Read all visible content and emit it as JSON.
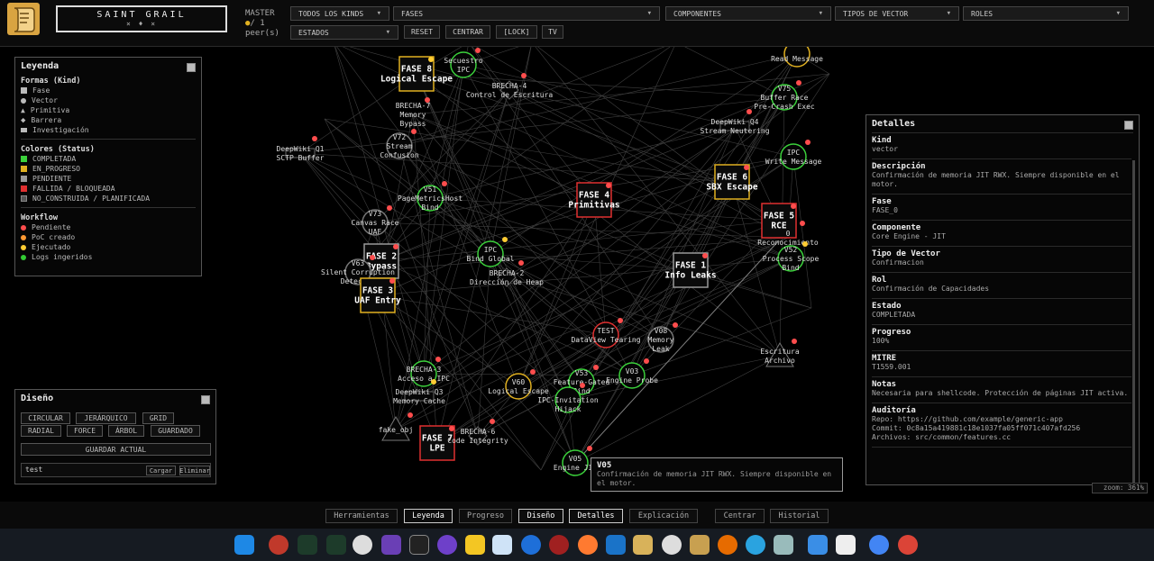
{
  "app": {
    "title": "SAINT GRAIL",
    "subtitle": "× ♦ ×",
    "master_label": "MASTER",
    "peers": "/ 1",
    "peers_label": "peer(s)"
  },
  "filters": {
    "kinds": "TODOS LOS KINDS",
    "fases": "FASES",
    "componentes": "COMPONENTES",
    "tipos": "TIPOS DE VECTOR",
    "roles": "ROLES",
    "estados": "ESTADOS",
    "reset": "RESET",
    "centrar": "CENTRAR",
    "lock": "[LOCK]",
    "tv": "TV"
  },
  "legend": {
    "title": "Leyenda",
    "shapes_title": "Formas (Kind)",
    "shapes": [
      "Fase",
      "Vector",
      "Primitiva",
      "Barrera",
      "Investigación"
    ],
    "colors_title": "Colores (Status)",
    "colors": [
      {
        "label": "COMPLETADA",
        "color": "#3bd13b"
      },
      {
        "label": "EN_PROGRESO",
        "color": "#e0b020"
      },
      {
        "label": "PENDIENTE",
        "color": "#999999"
      },
      {
        "label": "FALLIDA / BLOQUEADA",
        "color": "#e03030"
      },
      {
        "label": "NO_CONSTRUIDA / PLANIFICADA",
        "color": "#555555"
      }
    ],
    "workflow_title": "Workflow",
    "workflow": [
      {
        "label": "Pendiente",
        "color": "#ff4d4d"
      },
      {
        "label": "PoC creado",
        "color": "#ff9933"
      },
      {
        "label": "Ejecutado",
        "color": "#ffcc33"
      },
      {
        "label": "Logs ingeridos",
        "color": "#33cc33"
      }
    ]
  },
  "design": {
    "title": "Diseño",
    "layouts": [
      "CIRCULAR",
      "JERÁRQUICO",
      "GRID",
      "RADIAL",
      "FORCE",
      "ÁRBOL",
      "GUARDADO"
    ],
    "save": "GUARDAR ACTUAL",
    "input_value": "test",
    "load": "Cargar",
    "delete": "Eliminar"
  },
  "details": {
    "title": "Detalles",
    "fields": [
      {
        "k": "Kind",
        "v": "vector"
      },
      {
        "k": "Descripción",
        "v": "Confirmación de memoria JIT RWX. Siempre disponible en el motor."
      },
      {
        "k": "Fase",
        "v": "FASE_0"
      },
      {
        "k": "Componente",
        "v": "Core Engine - JIT"
      },
      {
        "k": "Tipo de Vector",
        "v": "Confirmacion"
      },
      {
        "k": "Rol",
        "v": "Confirmación de Capacidades"
      },
      {
        "k": "Estado",
        "v": "COMPLETADA"
      },
      {
        "k": "Progreso",
        "v": "100%"
      },
      {
        "k": "MITRE",
        "v": "T1559.001"
      },
      {
        "k": "Notas",
        "v": "Necesaria para shellcode. Protección de páginas JIT activa."
      },
      {
        "k": "Auditoría",
        "v": "Repo: https://github.com/example/generic-app\nCommit: 0c8a15a419881c18e1037fa05ff071c407afd256\nArchivos: src/common/features.cc"
      }
    ]
  },
  "zoom": "zoom: 361%",
  "tooltip": {
    "title": "V05",
    "text": "Confirmación de memoria JIT RWX. Siempre disponible en el motor."
  },
  "bottom": [
    "Herramientas",
    "Leyenda",
    "Progreso",
    "Diseño",
    "Detalles",
    "Explicación",
    "Centrar",
    "Historial"
  ],
  "bottom_active": [
    "Leyenda",
    "Diseño",
    "Detalles"
  ],
  "graph": {
    "nodes": [
      {
        "id": "f8",
        "t": "phase",
        "lines": [
          "FASE 8",
          "Logical Escape"
        ],
        "c": "#e0b020"
      },
      {
        "id": "sec",
        "t": "vector",
        "lines": [
          "Secuestro",
          "IPC"
        ],
        "c": "#3bd13b"
      },
      {
        "id": "b4",
        "t": "barrier",
        "lines": [
          "BRECHA-4",
          "Control de Escritura"
        ],
        "c": "#777"
      },
      {
        "id": "b7",
        "t": "text",
        "lines": [
          "BRECHA-7",
          "Memory",
          "Bypass"
        ],
        "c": "#777"
      },
      {
        "id": "v72",
        "t": "vector",
        "lines": [
          "V72",
          "Stream",
          "Confusion"
        ],
        "c": "#777"
      },
      {
        "id": "dw1",
        "t": "research",
        "lines": [
          "DeepWiki Q1",
          "SCTP Buffer"
        ],
        "c": "#777"
      },
      {
        "id": "v51",
        "t": "vector",
        "lines": [
          "V51",
          "PageMetricsHost",
          "Bind"
        ],
        "c": "#3bd13b"
      },
      {
        "id": "v73",
        "t": "vector",
        "lines": [
          "V73",
          "Canvas Race",
          "UAF"
        ],
        "c": "#777"
      },
      {
        "id": "f4",
        "t": "phase",
        "lines": [
          "FASE 4",
          "Primitivas"
        ],
        "c": "#e03030"
      },
      {
        "id": "ipcg",
        "t": "vector",
        "lines": [
          "IPC",
          "Bind Global"
        ],
        "c": "#3bd13b"
      },
      {
        "id": "b2",
        "t": "barrier",
        "lines": [
          "BRECHA-2",
          "Dirección de Heap"
        ],
        "c": "#777"
      },
      {
        "id": "f2",
        "t": "phase",
        "lines": [
          "FASE 2",
          "Bypass"
        ],
        "c": "#999"
      },
      {
        "id": "v63",
        "t": "vector",
        "lines": [
          "V63",
          "Silent Corruption",
          "Detector"
        ],
        "c": "#777"
      },
      {
        "id": "f3",
        "t": "phase",
        "lines": [
          "FASE 3",
          "UAF Entry"
        ],
        "c": "#e0b020"
      },
      {
        "id": "f1",
        "t": "phase",
        "lines": [
          "FASE 1",
          "Info Leaks"
        ],
        "c": "#999"
      },
      {
        "id": "f6",
        "t": "phase",
        "lines": [
          "FASE 6",
          "SBX Escape"
        ],
        "c": "#e0b020"
      },
      {
        "id": "f5",
        "t": "phase",
        "lines": [
          "FASE 5",
          "RCE"
        ],
        "c": "#e03030"
      },
      {
        "id": "recon",
        "t": "text",
        "lines": [
          "0",
          "Reconocimiento"
        ],
        "c": "#777"
      },
      {
        "id": "v52",
        "t": "vector",
        "lines": [
          "V52",
          "Process Scope",
          "Bind"
        ],
        "c": "#3bd13b"
      },
      {
        "id": "rm",
        "t": "vector",
        "lines": [
          "",
          "Read Message"
        ],
        "c": "#e0b020"
      },
      {
        "id": "v75",
        "t": "vector",
        "lines": [
          "V75",
          "Buffer Race",
          "Pre-Crash Exec"
        ],
        "c": "#3bd13b"
      },
      {
        "id": "dw4",
        "t": "research",
        "lines": [
          "DeepWiki Q4",
          "Stream Neutering"
        ],
        "c": "#777"
      },
      {
        "id": "ipcw",
        "t": "vector",
        "lines": [
          "IPC",
          "Write Message"
        ],
        "c": "#3bd13b"
      },
      {
        "id": "dv",
        "t": "vector",
        "lines": [
          "TEST",
          "DataView Tearing"
        ],
        "c": "#e03030"
      },
      {
        "id": "v08",
        "t": "vector",
        "lines": [
          "V08",
          "Memory",
          "Leak"
        ],
        "c": "#777"
      },
      {
        "id": "esc",
        "t": "prim",
        "lines": [
          "Escritura",
          "Archivo"
        ],
        "c": "#777"
      },
      {
        "id": "b3",
        "t": "vector",
        "lines": [
          "BRECHA-3",
          "Acceso a IPC"
        ],
        "c": "#3bd13b"
      },
      {
        "id": "dw3",
        "t": "research",
        "lines": [
          "DeepWiki Q3",
          "Memory Cache"
        ],
        "c": "#777"
      },
      {
        "id": "v60",
        "t": "vector",
        "lines": [
          "V60",
          "Logical Escape"
        ],
        "c": "#e0b020"
      },
      {
        "id": "v53",
        "t": "vector",
        "lines": [
          "V53",
          "Feature-Gated",
          "Bind"
        ],
        "c": "#3bd13b"
      },
      {
        "id": "ipci",
        "t": "vector",
        "lines": [
          "",
          "IPC-Invitation",
          "Hijack"
        ],
        "c": "#3bd13b"
      },
      {
        "id": "v03",
        "t": "vector",
        "lines": [
          "V03",
          "Engine Probe"
        ],
        "c": "#3bd13b"
      },
      {
        "id": "fake",
        "t": "prim",
        "lines": [
          "fake_obj"
        ],
        "c": "#777"
      },
      {
        "id": "f7",
        "t": "phase",
        "lines": [
          "FASE 7",
          "LPE"
        ],
        "c": "#e03030"
      },
      {
        "id": "b6",
        "t": "barrier",
        "lines": [
          "BRECHA-6",
          "Code Integrity"
        ],
        "c": "#777"
      },
      {
        "id": "v05",
        "t": "vector",
        "lines": [
          "V05",
          "Engine JIT"
        ],
        "c": "#3bd13b"
      }
    ]
  }
}
